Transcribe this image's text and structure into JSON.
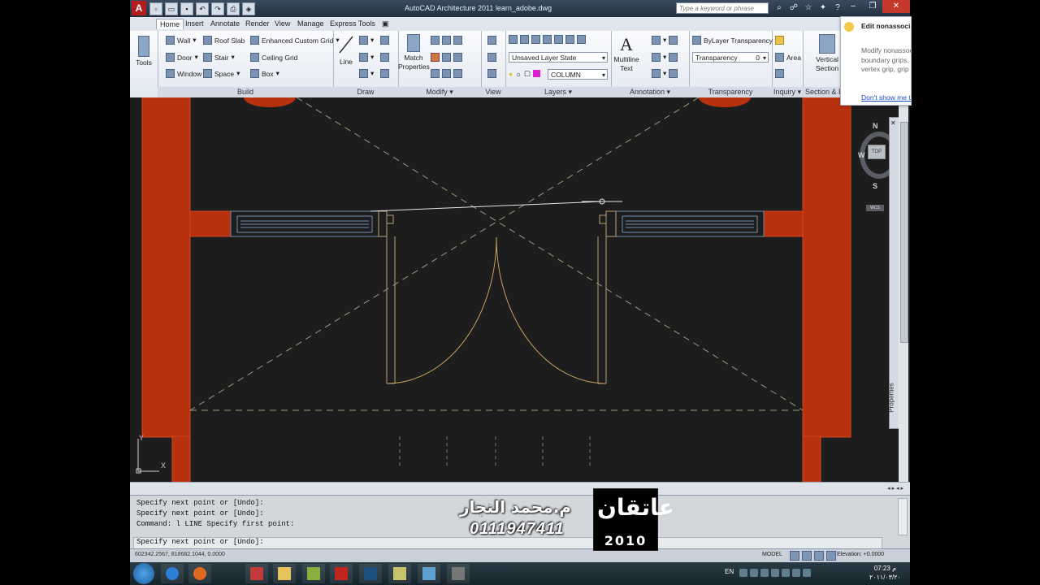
{
  "window": {
    "app_icon": "A",
    "title": "AutoCAD Architecture 2011     learn_adobe.dwg",
    "search_placeholder": "Type a keyword or phrase",
    "minimize": "–",
    "maximize": "❐",
    "close": "✕"
  },
  "tabs": [
    "Home",
    "Insert",
    "Annotate",
    "Render",
    "View",
    "Manage",
    "Express Tools"
  ],
  "ribbon": {
    "tools_label": "Tools",
    "build": {
      "title": "Build",
      "wall": "Wall",
      "door": "Door",
      "window": "Window",
      "roof_slab": "Roof Slab",
      "stair": "Stair",
      "space": "Space",
      "enhanced_grid": "Enhanced Custom Grid",
      "ceiling_grid": "Ceiling Grid",
      "box": "Box"
    },
    "draw": {
      "title": "Draw",
      "line": "Line"
    },
    "modify": {
      "title": "Modify",
      "match_properties": "Match\nProperties"
    },
    "view": {
      "title": "View"
    },
    "layers": {
      "title": "Layers",
      "layer_state": "Unsaved Layer State",
      "current_layer": "COLUMN"
    },
    "annotation": {
      "title": "Annotation",
      "multiline_text": "Multiline\nText"
    },
    "transparency": {
      "title": "Transparency",
      "bylayer": "ByLayer Transparency",
      "label": "Transparency",
      "value": "0"
    },
    "inquiry": {
      "title": "Inquiry",
      "area": "Area"
    },
    "section": {
      "title": "Section & Elevation",
      "vertical_section": "Vertical\nSection"
    }
  },
  "tooltip": {
    "title": "Edit nonassociative grips",
    "body": "Modify nonassociative using boundary grips. remove a vertex grip, grip to a line or arc",
    "link": "Don't show me this"
  },
  "viewcube": {
    "north": "N",
    "south": "S",
    "west": "W",
    "top": "TOP",
    "wcs": "WCS"
  },
  "properties_palette": {
    "label": "Properties"
  },
  "ucs": {
    "x": "X",
    "y": "Y"
  },
  "command_history": [
    "Specify next point or [Undo]:",
    "Specify next point or [Undo]:",
    "Command: l LINE Specify first point:",
    "Specify next point or [Undo]:"
  ],
  "status": {
    "coords": "602342.2567, 818682.1044, 0.0000",
    "model": "MODEL",
    "elevation": "Elevation: +0.0000"
  },
  "watermark": {
    "name": "م.محمد النجار",
    "phone": "0111947411",
    "logo_text": "عاتقان",
    "logo_year": "2010"
  },
  "taskbar": {
    "lang": "EN",
    "time": "07:23 م",
    "date": "٢٠١١/٠٣/٢٠"
  },
  "colors": {
    "wall_red": "#b8310f",
    "drawing_bg": "#1d1d1e",
    "door_arc": "#c9a15a",
    "window_blue": "#6a8fb0"
  }
}
